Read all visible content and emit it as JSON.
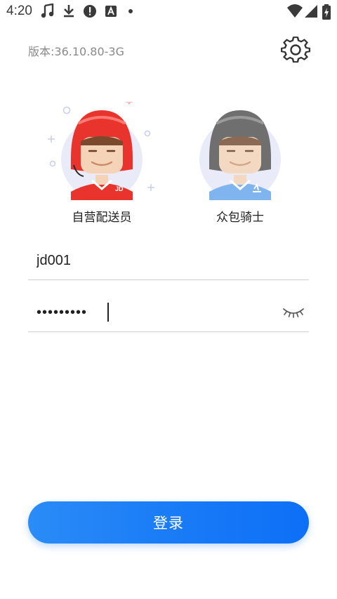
{
  "status_bar": {
    "time": "4:20",
    "icons": [
      "music-note-icon",
      "download-icon",
      "alert-icon",
      "a-icon",
      "dot-icon",
      "wifi-icon",
      "signal-icon",
      "battery-icon"
    ]
  },
  "header": {
    "version": "版本:36.10.80-3G"
  },
  "roles": [
    {
      "label": "自营配送员",
      "helmet_color": "#e8342c"
    },
    {
      "label": "众包骑士",
      "helmet_color": "#6f6f6f"
    }
  ],
  "form": {
    "username": "jd001",
    "password": "•••••••••"
  },
  "login": {
    "label": "登录",
    "color": "#1a7cf6"
  }
}
